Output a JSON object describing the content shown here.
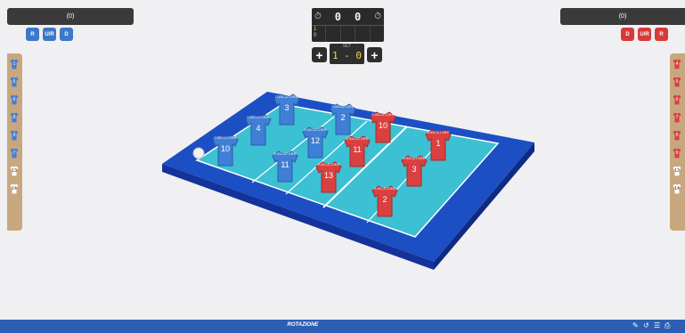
{
  "teams": {
    "left": {
      "name": "(0)",
      "buttons": [
        "R",
        "U/R",
        "D"
      ],
      "color": "#3d78c9"
    },
    "right": {
      "name": "(0)",
      "buttons": [
        "D",
        "U/R",
        "R"
      ],
      "color": "#d83a3a"
    }
  },
  "scoreboard": {
    "left_score": "0",
    "right_score": "0",
    "set_col1_a": "1",
    "set_col1_b": "0"
  },
  "set_display": {
    "label": "SET",
    "value": "1 - 0"
  },
  "bench_left": [
    "1",
    "5",
    "6",
    "8",
    "9",
    "7",
    "13",
    "14"
  ],
  "bench_right": [
    "4",
    "5",
    "6",
    "7",
    "8",
    "9",
    "12",
    "14"
  ],
  "players": {
    "blue": [
      {
        "name": "GIOCATORE",
        "number": "3"
      },
      {
        "name": "GIOCATORE",
        "number": "4"
      },
      {
        "name": "GIOCATORE",
        "number": "2"
      },
      {
        "name": "GIOCATORE",
        "number": "12"
      },
      {
        "name": "GIOCATORE",
        "number": "10"
      },
      {
        "name": "GIOCATORE",
        "number": "11"
      }
    ],
    "red": [
      {
        "name": "GIOCATORE",
        "number": "10"
      },
      {
        "name": "GIOCATORE",
        "number": "1"
      },
      {
        "name": "GIOCATORE",
        "number": "11"
      },
      {
        "name": "GIOCATORE",
        "number": "3"
      },
      {
        "name": "GIOCATORE",
        "number": "13"
      },
      {
        "name": "GIOCATORE",
        "number": "2"
      }
    ]
  },
  "footer": {
    "title": "ROTAZIONE"
  },
  "icons": [
    "edit-icon",
    "undo-icon",
    "list-icon",
    "print-icon"
  ]
}
